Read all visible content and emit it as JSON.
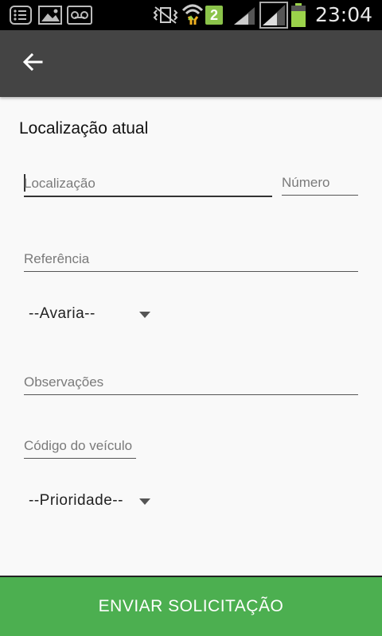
{
  "status_bar": {
    "time": "23:04",
    "sim_badge": "2",
    "icons": [
      "notes-icon",
      "image-icon",
      "voicemail-icon",
      "vibrate-icon",
      "wifi-icon",
      "signal-icon",
      "signal-icon",
      "battery-icon"
    ]
  },
  "app_bar": {
    "back_icon": "arrow-back-icon"
  },
  "form": {
    "title": "Localização atual",
    "location_placeholder": "Localização",
    "number_placeholder": "Número",
    "reference_placeholder": "Referência",
    "damage_select": "--Avaria--",
    "notes_placeholder": "Observações",
    "vehicle_code_placeholder": "Código do veículo",
    "priority_select": "--Prioridade--"
  },
  "submit_label": "ENVIAR SOLICITAÇÃO",
  "colors": {
    "appbar": "#444444",
    "button": "#4caf50",
    "statusbar": "#000000"
  }
}
